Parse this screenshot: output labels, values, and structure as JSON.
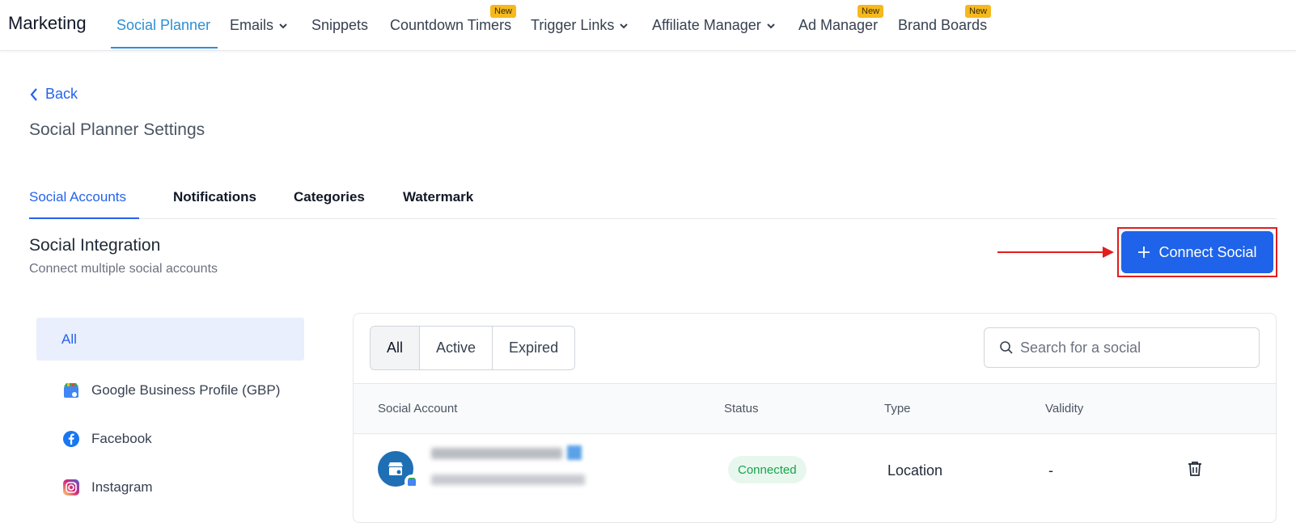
{
  "nav": {
    "brand": "Marketing",
    "items": [
      {
        "label": "Social Planner"
      },
      {
        "label": "Emails"
      },
      {
        "label": "Snippets"
      },
      {
        "label": "Countdown Timers"
      },
      {
        "label": "Trigger Links"
      },
      {
        "label": "Affiliate Manager"
      },
      {
        "label": "Ad Manager"
      },
      {
        "label": "Brand Boards"
      }
    ],
    "badge_label": "New"
  },
  "header": {
    "back_label": "Back",
    "page_title": "Social Planner Settings"
  },
  "tabs": [
    {
      "label": "Social Accounts"
    },
    {
      "label": "Notifications"
    },
    {
      "label": "Categories"
    },
    {
      "label": "Watermark"
    }
  ],
  "section": {
    "title": "Social Integration",
    "subtitle": "Connect multiple social accounts",
    "connect_button": "Connect Social"
  },
  "left_list": [
    {
      "label": "All",
      "icon": "none"
    },
    {
      "label": "Google Business Profile (GBP)",
      "icon": "gbp-icon"
    },
    {
      "label": "Facebook",
      "icon": "facebook-icon"
    },
    {
      "label": "Instagram",
      "icon": "instagram-icon"
    }
  ],
  "filters": {
    "segments": [
      {
        "label": "All"
      },
      {
        "label": "Active"
      },
      {
        "label": "Expired"
      }
    ],
    "search_placeholder": "Search for a social"
  },
  "table": {
    "headers": {
      "account": "Social Account",
      "status": "Status",
      "type": "Type",
      "validity": "Validity"
    },
    "rows": [
      {
        "status": "Connected",
        "type": "Location",
        "validity": "-"
      }
    ]
  },
  "colors": {
    "primary": "#1e63e9",
    "nav_active": "#2b8fd6",
    "badge": "#f5b91e",
    "annotation": "#e11d1d",
    "connected": "#16a34a"
  }
}
